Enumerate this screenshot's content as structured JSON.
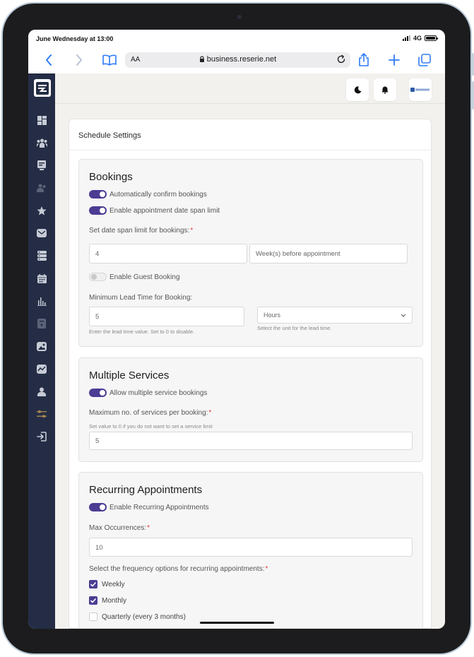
{
  "colors": {
    "accent": "#4c3c93",
    "sidebar_bg": "#242d45",
    "link_blue": "#2f7bf6",
    "required": "#e23a3a"
  },
  "status_bar": {
    "time": "June Wednesday at 13:00",
    "network": "4G",
    "battery_level_pct": 100
  },
  "browser": {
    "text_size_label": "AA",
    "url": "business.reserie.net",
    "icons": [
      "back-icon",
      "forward-icon",
      "bookmarks-icon",
      "lock-icon",
      "reload-icon",
      "share-icon",
      "new-tab-icon",
      "tabs-icon"
    ]
  },
  "sidebar": {
    "items": [
      "dashboard-icon",
      "staff-icon",
      "bookings-icon",
      "customers-icon",
      "reviews-icon",
      "messages-icon",
      "services-icon",
      "calendar-icon",
      "reports-icon",
      "invoices-icon",
      "gallery-icon",
      "analytics-icon",
      "profile-icon",
      "settings-icon",
      "logout-icon"
    ],
    "active": "settings-icon"
  },
  "topbar": {
    "icons": [
      "dark-mode-icon",
      "notifications-icon",
      "business-logo"
    ]
  },
  "page": {
    "title": "Schedule Settings"
  },
  "bookings": {
    "heading": "Bookings",
    "auto_confirm": {
      "label": "Automatically confirm bookings",
      "on": true
    },
    "date_span_toggle": {
      "label": "Enable appointment date span limit",
      "on": true
    },
    "date_span_label": "Set date span limit for bookings:",
    "date_span_value": "4",
    "date_span_unit": "Week(s) before appointment",
    "guest_booking": {
      "label": "Enable Guest Booking",
      "on": false
    },
    "lead_time_label": "Minimum Lead Time for Booking:",
    "lead_time_value": "5",
    "lead_time_help": "Enter the lead time value. Set to 0 to disable.",
    "lead_unit_value": "Hours",
    "lead_unit_help": "Select the unit for the lead time."
  },
  "multiple_services": {
    "heading": "Multiple Services",
    "allow": {
      "label": "Allow multiple service bookings",
      "on": true
    },
    "max_label": "Maximum no. of services per booking:",
    "max_help": "Set value to 0 if you do not want to set a service limit",
    "max_value": "5"
  },
  "recurring": {
    "heading": "Recurring Appointments",
    "enable": {
      "label": "Enable Recurring Appointments",
      "on": true
    },
    "max_occ_label": "Max Occurrences:",
    "max_occ_value": "10",
    "freq_label": "Select the frequency options for recurring appointments:",
    "options": [
      {
        "label": "Weekly",
        "checked": true
      },
      {
        "label": "Monthly",
        "checked": true
      },
      {
        "label": "Quarterly (every 3 months)",
        "checked": false
      }
    ]
  },
  "required_mark": "*"
}
